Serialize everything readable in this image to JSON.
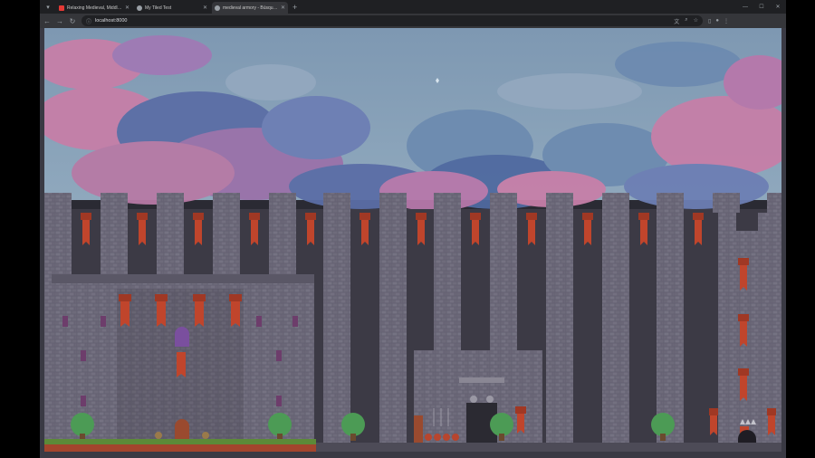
{
  "browser": {
    "tabs": [
      {
        "title": "Relaxing Medieval, Middle Ag",
        "favicon_color": "#e53935",
        "active": false
      },
      {
        "title": "My Tiled Test",
        "favicon_color": "#9aa0a6",
        "active": false
      },
      {
        "title": "medieval armory - Búsqueda c",
        "favicon_color": "#9aa0a6",
        "active": true
      }
    ],
    "new_tab_glyph": "+",
    "address": "localhost:8000",
    "icons": [
      "back-icon",
      "forward-icon",
      "reload-icon",
      "translate-icon",
      "zoom-icon",
      "bookmark-star-icon",
      "sidebar-icon",
      "profile-icon",
      "menu-icon"
    ]
  },
  "game": {
    "sky_color": "#8aa4ba",
    "cloud_colors": [
      "#c67fa8",
      "#8a8cc0",
      "#5b6ea6",
      "#6d8bb0"
    ],
    "wall_color": "#646172",
    "dark_wall_color": "#3c3a45",
    "banner_color": "#c0452c",
    "tree_color": "#4c9b55",
    "grass_color": "#5c8a38"
  }
}
